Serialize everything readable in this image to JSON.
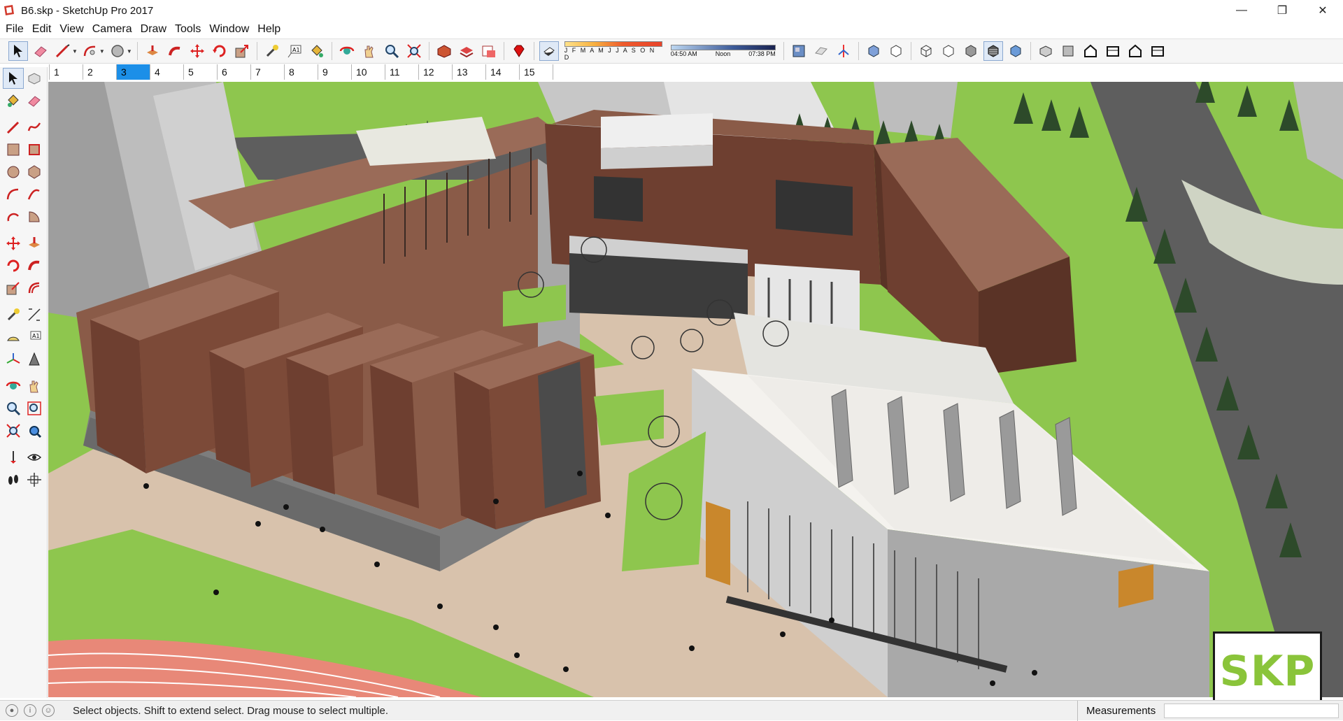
{
  "window": {
    "title": "B6.skp - SketchUp Pro 2017",
    "minimize_glyph": "—",
    "maximize_glyph": "❐",
    "close_glyph": "✕"
  },
  "menu": [
    {
      "label": "File"
    },
    {
      "label": "Edit"
    },
    {
      "label": "View"
    },
    {
      "label": "Camera"
    },
    {
      "label": "Draw"
    },
    {
      "label": "Tools"
    },
    {
      "label": "Window"
    },
    {
      "label": "Help"
    }
  ],
  "shadow_panel": {
    "months": "J F M A M J J A S O N D",
    "time_start": "04:50 AM",
    "time_mid": "Noon",
    "time_end": "07:38 PM"
  },
  "scenes": {
    "tabs": [
      "1",
      "2",
      "3",
      "4",
      "5",
      "6",
      "7",
      "8",
      "9",
      "10",
      "11",
      "12",
      "13",
      "14",
      "15"
    ],
    "active_index": 2
  },
  "status": {
    "hint": "Select objects. Shift to extend select. Drag mouse to select multiple.",
    "measurements_label": "Measurements",
    "measurements_value": ""
  },
  "badge": {
    "text": "SKP"
  },
  "colors": {
    "accent_blue": "#1c8fe8",
    "brick": "#6e3f30",
    "roof": "#9a6b58",
    "grass": "#8ec64e",
    "paving": "#d8c2ac",
    "track": "#e88878",
    "badge_green": "#8ac43a"
  },
  "icons": {
    "main_toolbar": [
      "select-arrow-icon",
      "eraser-icon",
      "pencil-line-icon",
      "arc-icon",
      "circle-icon",
      "push-pull-icon",
      "follow-me-icon",
      "move-icon",
      "rotate-icon",
      "scale-icon",
      "tape-measure-icon",
      "text-icon",
      "paint-bucket-icon",
      "orbit-icon",
      "pan-icon",
      "zoom-icon",
      "zoom-extents-icon",
      "warehouse-icon",
      "extension-warehouse-icon",
      "layout-icon",
      "ruby-icon",
      "shadow-toggle-icon",
      "model-info-icon",
      "styles-icon",
      "components-icon",
      "xray-icon",
      "back-edges-icon",
      "wireframe-icon",
      "hidden-line-icon",
      "shaded-icon",
      "shaded-textures-icon",
      "monochrome-icon",
      "iso-view-icon",
      "top-view-icon",
      "front-view-icon",
      "right-view-icon",
      "back-view-icon",
      "left-view-icon"
    ],
    "left_toolbar": [
      "select-icon",
      "make-component-icon",
      "paint-bucket-icon",
      "eraser-icon",
      "line-icon",
      "freehand-icon",
      "rectangle-icon",
      "rotated-rectangle-icon",
      "circle-icon",
      "polygon-icon",
      "arc-icon",
      "two-point-arc-icon",
      "three-point-arc-icon",
      "pie-icon",
      "move-icon",
      "push-pull-icon",
      "rotate-icon",
      "follow-me-icon",
      "scale-icon",
      "offset-icon",
      "tape-measure-icon",
      "dimension-icon",
      "protractor-icon",
      "text-icon",
      "axes-icon",
      "3d-text-icon",
      "orbit-icon",
      "pan-icon",
      "zoom-icon",
      "zoom-window-icon",
      "zoom-extents-icon",
      "previous-view-icon",
      "position-camera-icon",
      "look-around-icon",
      "walk-icon",
      "section-plane-icon"
    ]
  }
}
